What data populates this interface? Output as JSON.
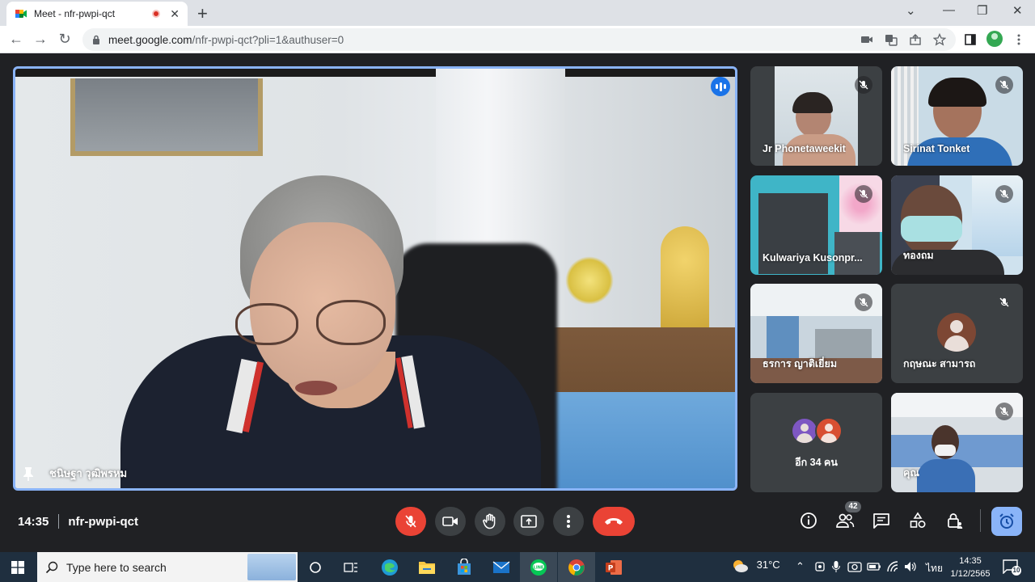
{
  "browser": {
    "tab_title": "Meet - nfr-pwpi-qct",
    "new_tab": "+",
    "url_host": "meet.google.com",
    "url_path": "/nfr-pwpi-qct?pli=1&authuser=0"
  },
  "main_video": {
    "participant_name": "ชนิษฐา วุฒิพรหม"
  },
  "tiles": [
    {
      "name": "Jr Phonetaweekit",
      "muted": true
    },
    {
      "name": "Sirinat Tonket",
      "muted": true
    },
    {
      "name": "Kulwariya Kusonpr...",
      "muted": true
    },
    {
      "name": "ทองถม",
      "muted": true
    },
    {
      "name": "ธรการ ญาติเยี่ยม",
      "muted": true
    },
    {
      "name": "กฤษณะ สามารถ",
      "muted": true
    },
    {
      "name": "",
      "more_label": "อีก 34 คน"
    },
    {
      "name": "คุณ",
      "muted": true
    }
  ],
  "controls": {
    "time": "14:35",
    "meeting_code": "nfr-pwpi-qct",
    "people_count": "42"
  },
  "taskbar": {
    "search_placeholder": "Type here to search",
    "weather": "31°C",
    "language": "ไทย",
    "time": "14:35",
    "date": "1/12/2565",
    "notifications": "10"
  },
  "colors": {
    "meet_bg": "#202124",
    "active_border": "#8ab4f8",
    "red": "#ea4335",
    "blue": "#1a73e8"
  }
}
